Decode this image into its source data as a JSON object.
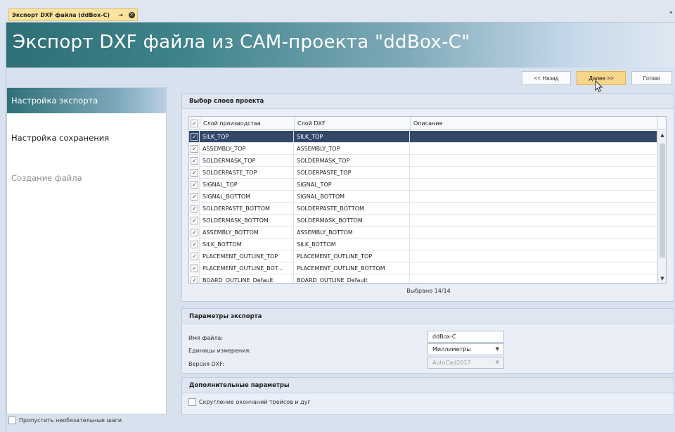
{
  "tab": {
    "title": "Экспорт DXF файла (ddBox-C)",
    "pin": "⇥",
    "close": "✕",
    "menu": "▾"
  },
  "banner": {
    "title": "Экспорт DXF файла из CAM-проекта \"ddBox-C\""
  },
  "nav": {
    "back": "<< Назад",
    "next": "Далее >>",
    "done": "Готово"
  },
  "steps": [
    {
      "label": "Настройка экспорта",
      "state": "active"
    },
    {
      "label": "Настройка сохранения",
      "state": "normal"
    },
    {
      "label": "Создание файла",
      "state": "disabled"
    }
  ],
  "skip": {
    "label": "Пропустить необязательные шаги",
    "checked": false
  },
  "layers_panel": {
    "title": "Выбор слоев проекта",
    "columns": [
      "Слой производства",
      "Слой DXF",
      "Описание"
    ],
    "header_checked": true,
    "rows": [
      {
        "prod": "SILK_TOP",
        "dxf": "SILK_TOP",
        "desc": "",
        "checked": true,
        "selected": true
      },
      {
        "prod": "ASSEMBLY_TOP",
        "dxf": "ASSEMBLY_TOP",
        "desc": "",
        "checked": true
      },
      {
        "prod": "SOLDERMASK_TOP",
        "dxf": "SOLDERMASK_TOP",
        "desc": "",
        "checked": true
      },
      {
        "prod": "SOLDERPASTE_TOP",
        "dxf": "SOLDERPASTE_TOP",
        "desc": "",
        "checked": true
      },
      {
        "prod": "SIGNAL_TOP",
        "dxf": "SIGNAL_TOP",
        "desc": "",
        "checked": true
      },
      {
        "prod": "SIGNAL_BOTTOM",
        "dxf": "SIGNAL_BOTTOM",
        "desc": "",
        "checked": true
      },
      {
        "prod": "SOLDERPASTE_BOTTOM",
        "dxf": "SOLDERPASTE_BOTTOM",
        "desc": "",
        "checked": true
      },
      {
        "prod": "SOLDERMASK_BOTTOM",
        "dxf": "SOLDERMASK_BOTTOM",
        "desc": "",
        "checked": true
      },
      {
        "prod": "ASSEMBLY_BOTTOM",
        "dxf": "ASSEMBLY_BOTTOM",
        "desc": "",
        "checked": true
      },
      {
        "prod": "SILK_BOTTOM",
        "dxf": "SILK_BOTTOM",
        "desc": "",
        "checked": true
      },
      {
        "prod": "PLACEMENT_OUTLINE_TOP",
        "dxf": "PLACEMENT_OUTLINE_TOP",
        "desc": "",
        "checked": true
      },
      {
        "prod": "PLACEMENT_OUTLINE_BOT...",
        "dxf": "PLACEMENT_OUTLINE_BOTTOM",
        "desc": "",
        "checked": true
      },
      {
        "prod": "BOARD_OUTLINE_Default",
        "dxf": "BOARD_OUTLINE_Default",
        "desc": "",
        "checked": true
      }
    ],
    "selected_count": "Выбрано 14/14"
  },
  "export_params": {
    "title": "Параметры экспорта",
    "filename_label": "Имя файла:",
    "filename_value": "ddBox-C",
    "units_label": "Единицы измерения:",
    "units_value": "Миллиметры",
    "version_label": "Версия DXF:",
    "version_value": "AutoCad2017"
  },
  "extra_params": {
    "title": "Дополнительные параметры",
    "round_label": "Скругление окончаний трейсов и дуг",
    "round_checked": false
  },
  "colors": {
    "accent": "#2f6f76",
    "selected_row": "#34496a",
    "next_button": "#f7d58a"
  }
}
